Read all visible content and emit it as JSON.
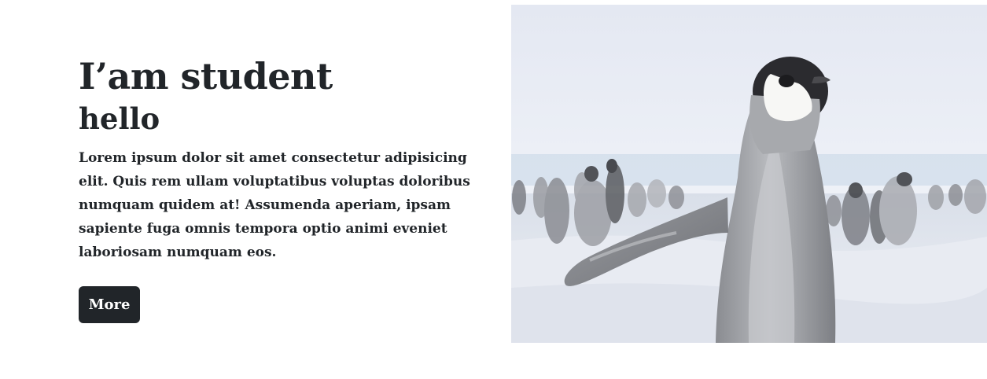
{
  "hero": {
    "title": "I’am student",
    "subtitle": "hello",
    "body": "Lorem ipsum dolor sit amet consectetur adipisicing elit. Quis rem ullam voluptatibus voluptas doloribus numquam quidem at! Assumenda aperiam, ipsam sapiente fuga omnis tempora optio animi eveniet laboriosam numquam eos.",
    "button_label": "More"
  },
  "photo": {
    "subject": "penguin-photo"
  },
  "colors": {
    "text": "#212529",
    "button_bg": "#212529",
    "button_text": "#ffffff",
    "sky": "#e9edf5",
    "snow": "#e6e9f1"
  }
}
